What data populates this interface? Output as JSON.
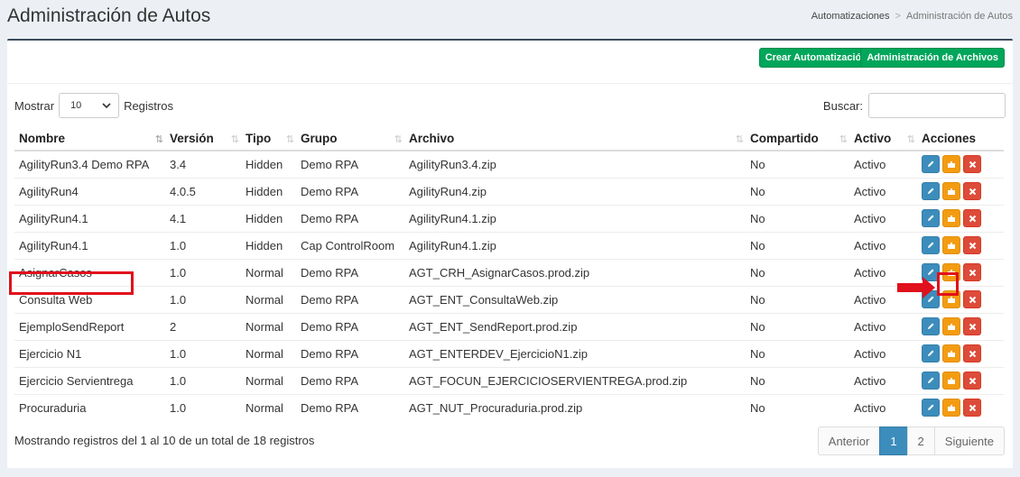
{
  "page": {
    "title": "Administración de Autos"
  },
  "breadcrumb": {
    "parent": "Automatizaciones",
    "separator": ">",
    "current": "Administración de Autos"
  },
  "toolbar": {
    "create_label": "Crear Automatización",
    "files_label": "Administración de Archivos"
  },
  "length": {
    "prefix": "Mostrar",
    "value": "10",
    "suffix": "Registros"
  },
  "search": {
    "label": "Buscar:",
    "value": ""
  },
  "table": {
    "columns": [
      "Nombre",
      "Versión",
      "Tipo",
      "Grupo",
      "Archivo",
      "Compartido",
      "Activo",
      "Acciones"
    ],
    "rows": [
      [
        "AgilityRun3.4 Demo RPA",
        "3.4",
        "Hidden",
        "Demo RPA",
        "AgilityRun3.4.zip",
        "No",
        "Activo"
      ],
      [
        "AgilityRun4",
        "4.0.5",
        "Hidden",
        "Demo RPA",
        "AgilityRun4.zip",
        "No",
        "Activo"
      ],
      [
        "AgilityRun4.1",
        "4.1",
        "Hidden",
        "Demo RPA",
        "AgilityRun4.1.zip",
        "No",
        "Activo"
      ],
      [
        "AgilityRun4.1",
        "1.0",
        "Hidden",
        "Cap ControlRoom",
        "AgilityRun4.1.zip",
        "No",
        "Activo"
      ],
      [
        "AsignarCasos",
        "1.0",
        "Normal",
        "Demo RPA",
        "AGT_CRH_AsignarCasos.prod.zip",
        "No",
        "Activo"
      ],
      [
        "Consulta Web",
        "1.0",
        "Normal",
        "Demo RPA",
        "AGT_ENT_ConsultaWeb.zip",
        "No",
        "Activo"
      ],
      [
        "EjemploSendReport",
        "2",
        "Normal",
        "Demo RPA",
        "AGT_ENT_SendReport.prod.zip",
        "No",
        "Activo"
      ],
      [
        "Ejercicio N1",
        "1.0",
        "Normal",
        "Demo RPA",
        "AGT_ENTERDEV_EjercicioN1.zip",
        "No",
        "Activo"
      ],
      [
        "Ejercicio Servientrega",
        "1.0",
        "Normal",
        "Demo RPA",
        "AGT_FOCUN_EJERCICIOSERVIENTREGA.prod.zip",
        "No",
        "Activo"
      ],
      [
        "Procuraduria",
        "1.0",
        "Normal",
        "Demo RPA",
        "AGT_NUT_Procuraduria.prod.zip",
        "No",
        "Activo"
      ]
    ],
    "action_icons": [
      "pencil-icon",
      "puzzle-icon",
      "close-icon"
    ]
  },
  "info": "Mostrando registros del 1 al 10 de un total de 18 registros",
  "pagination": {
    "prev": "Anterior",
    "pages": [
      "1",
      "2"
    ],
    "active": "1",
    "next": "Siguiente"
  },
  "colors": {
    "header_bar": "#3c4b5c",
    "success": "#00a65a",
    "edit": "#3c8dbc",
    "run": "#f39c12",
    "delete": "#dd4b39",
    "highlight": "#e0101c"
  }
}
